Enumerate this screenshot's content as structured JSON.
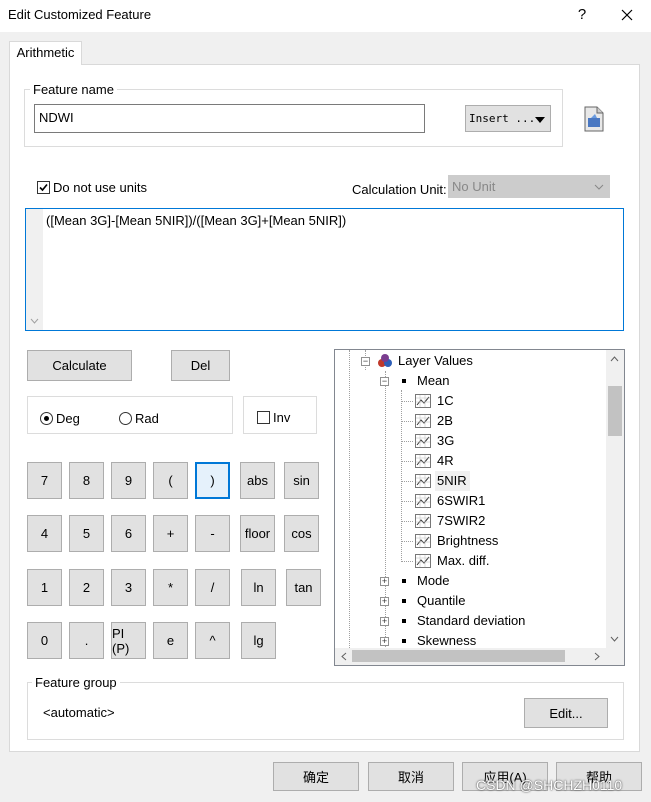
{
  "window": {
    "title": "Edit Customized Feature",
    "help_label": "?",
    "close_label": "✕"
  },
  "tabs": [
    {
      "label": "Arithmetic",
      "active": true
    }
  ],
  "feature_name": {
    "legend": "Feature name",
    "value": "NDWI",
    "insert_label": "Insert ..."
  },
  "units": {
    "do_not_use_label": "Do not use units",
    "checked": true,
    "calc_unit_label": "Calculation Unit:",
    "calc_unit_value": "No Unit"
  },
  "expression": "([Mean 3G]-[Mean 5NIR])/([Mean 3G]+[Mean 5NIR])",
  "actions": {
    "calculate": "Calculate",
    "del": "Del"
  },
  "angle": {
    "deg": "Deg",
    "rad": "Rad",
    "selected": "deg",
    "inv": "Inv"
  },
  "keypad": [
    [
      "7",
      "8",
      "9",
      "(",
      ")",
      "abs",
      "sin"
    ],
    [
      "4",
      "5",
      "6",
      "+",
      "-",
      "floor",
      "cos"
    ],
    [
      "1",
      "2",
      "3",
      "*",
      "/",
      "ln",
      "tan"
    ],
    [
      "0",
      ".",
      "PI (P)",
      "e",
      "^",
      "lg"
    ]
  ],
  "tree": {
    "root": "Layer Values",
    "mean": "Mean",
    "mean_children": [
      "1C",
      "2B",
      "3G",
      "4R",
      "5NIR",
      "6SWIR1",
      "7SWIR2",
      "Brightness",
      "Max. diff."
    ],
    "selected": "5NIR",
    "siblings": [
      "Mode",
      "Quantile",
      "Standard deviation",
      "Skewness"
    ]
  },
  "feature_group": {
    "legend": "Feature group",
    "value": "<automatic>",
    "edit_label": "Edit..."
  },
  "footer": {
    "ok": "确定",
    "cancel": "取消",
    "apply": "应用(A)",
    "help": "帮助"
  },
  "watermark": "CSDN @SHCHZH0110"
}
